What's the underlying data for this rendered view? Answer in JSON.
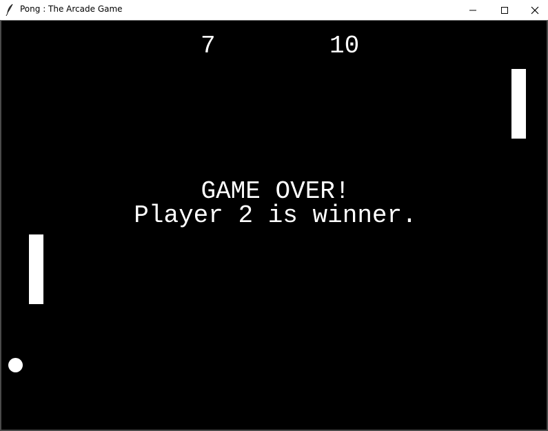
{
  "window": {
    "title": "Pong : The Arcade Game",
    "icon": "feather-icon",
    "controls": [
      "minimize-icon",
      "maximize-icon",
      "close-icon"
    ]
  },
  "game": {
    "background_color": "#000000",
    "foreground_color": "#ffffff",
    "score": {
      "player1": "7",
      "player2": "10"
    },
    "message": {
      "line1": "GAME OVER!",
      "line2": "Player 2 is winner."
    }
  }
}
